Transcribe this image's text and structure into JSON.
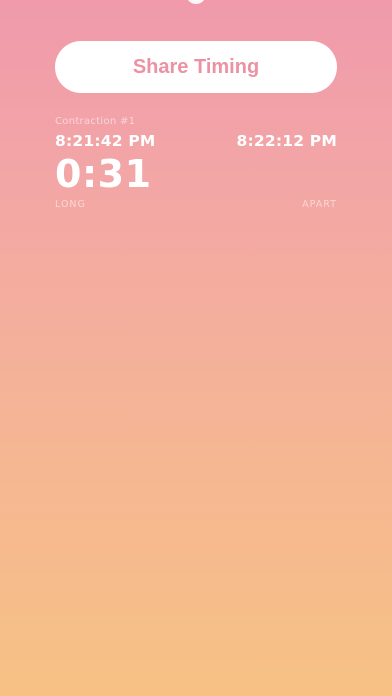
{
  "share_button": {
    "label": "Share Timing"
  },
  "contraction": {
    "label": "Contraction #1",
    "start_time": "8:21:42 PM",
    "end_time": "8:22:12 PM",
    "duration": "0:31",
    "duration_label": "LONG",
    "interval_label": "APART"
  },
  "colors": {
    "gradient_top": "#f09aac",
    "gradient_bottom": "#f7c184",
    "accent": "#ec92a3"
  }
}
